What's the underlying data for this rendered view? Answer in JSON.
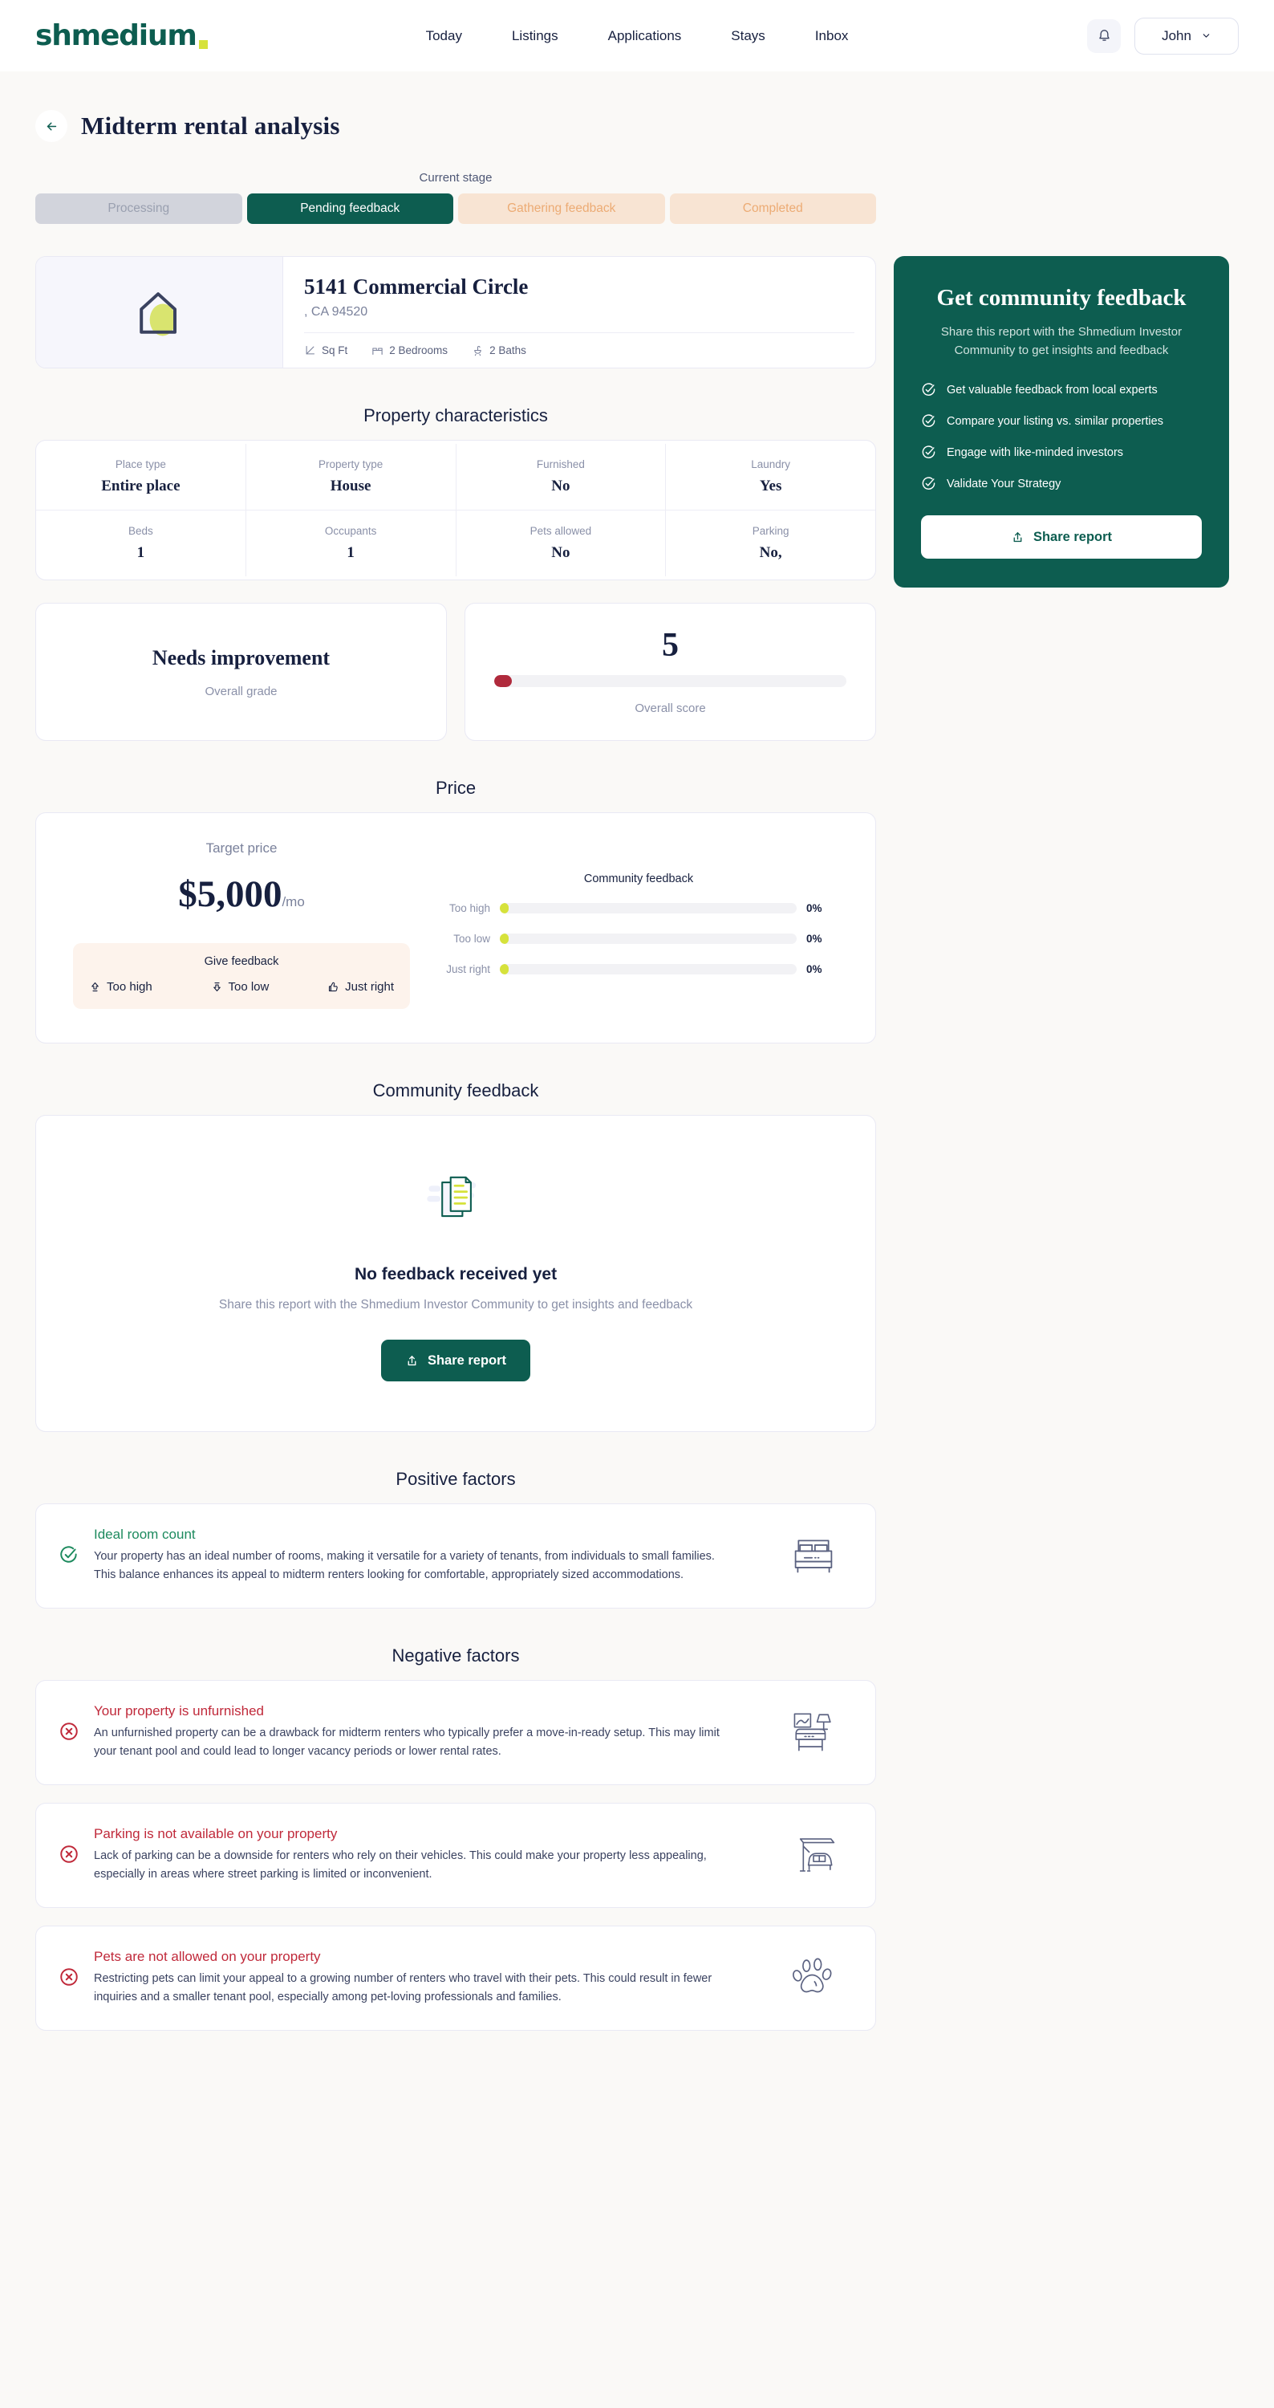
{
  "brand": {
    "name": "shmedium",
    "logo_color": "#0d5d50",
    "dot_color": "#d6e23b"
  },
  "nav": {
    "links": [
      "Today",
      "Listings",
      "Applications",
      "Stays",
      "Inbox"
    ],
    "bell_icon": "bell-icon",
    "user_name": "John",
    "user_caret": "chevron-down-icon"
  },
  "header": {
    "back_icon": "arrow-left-icon",
    "title": "Midterm rental analysis"
  },
  "stage": {
    "label": "Current stage",
    "items": [
      {
        "label": "Processing",
        "state": "done"
      },
      {
        "label": "Pending feedback",
        "state": "active"
      },
      {
        "label": "Gathering feedback",
        "state": "pending"
      },
      {
        "label": "Completed",
        "state": "pending"
      }
    ]
  },
  "property": {
    "thumb_icon": "house-icon",
    "address": "5141 Commercial Circle",
    "location": ", CA 94520",
    "specs": [
      {
        "icon": "area-icon",
        "label": "Sq Ft"
      },
      {
        "icon": "bed-icon",
        "label": "2 Bedrooms"
      },
      {
        "icon": "bath-icon",
        "label": "2 Baths"
      }
    ]
  },
  "characteristics": {
    "title": "Property characteristics",
    "rows": [
      [
        {
          "key": "Place type",
          "value": "Entire place"
        },
        {
          "key": "Property type",
          "value": "House"
        },
        {
          "key": "Furnished",
          "value": "No"
        },
        {
          "key": "Laundry",
          "value": "Yes"
        }
      ],
      [
        {
          "key": "Beds",
          "value": "1"
        },
        {
          "key": "Occupants",
          "value": "1"
        },
        {
          "key": "Pets allowed",
          "value": "No"
        },
        {
          "key": "Parking",
          "value": "No,"
        }
      ]
    ]
  },
  "community_panel": {
    "title": "Get community feedback",
    "subtitle": "Share this report with the Shmedium Investor Community to get insights and feedback",
    "bullets": [
      "Get valuable feedback from local experts",
      "Compare your listing vs. similar properties",
      "Engage with like-minded investors",
      "Validate Your Strategy"
    ],
    "share_label": "Share report",
    "share_icon": "share-icon",
    "bg_color": "#0d5d50"
  },
  "scores": {
    "grade_value": "Needs improvement",
    "grade_caption": "Overall grade",
    "score_value": "5",
    "score_caption": "Overall score",
    "score_fill_pct": 5,
    "score_fill_color": "#b02a3c"
  },
  "price": {
    "title": "Price",
    "target_caption": "Target price",
    "amount": "$5,000",
    "period": "/mo",
    "feedback_title": "Give feedback",
    "feedback_options": [
      {
        "icon": "arrow-up-icon",
        "label": "Too high"
      },
      {
        "icon": "arrow-down-icon",
        "label": "Too low"
      },
      {
        "icon": "thumbs-up-icon",
        "label": "Just right"
      }
    ],
    "community_title": "Community feedback",
    "bars": [
      {
        "label": "Too high",
        "pct": 0,
        "pct_label": "0%"
      },
      {
        "label": "Too low",
        "pct": 0,
        "pct_label": "0%"
      },
      {
        "label": "Just right",
        "pct": 0,
        "pct_label": "0%"
      }
    ],
    "bar_color": "#d6e23b"
  },
  "community_feedback": {
    "title": "Community feedback",
    "empty_icon": "document-icon",
    "empty_title": "No feedback received yet",
    "empty_sub": "Share this report with the Shmedium Investor Community to get insights and feedback",
    "share_label": "Share report",
    "share_icon": "share-icon"
  },
  "positive": {
    "title": "Positive factors",
    "items": [
      {
        "title": "Ideal room count",
        "desc": "Your property has an ideal number of rooms, making it versatile for a variety of tenants, from individuals to small families. This balance enhances its appeal to midterm renters looking for comfortable, appropriately sized accommodations.",
        "status_icon": "check-circle-icon",
        "art_icon": "bed-art-icon"
      }
    ]
  },
  "negative": {
    "title": "Negative factors",
    "items": [
      {
        "title": "Your property is unfurnished",
        "desc": "An unfurnished property can be a drawback for midterm renters who typically prefer a move-in-ready setup. This may limit your tenant pool and could lead to longer vacancy periods or lower rental rates.",
        "status_icon": "x-circle-icon",
        "art_icon": "furniture-art-icon"
      },
      {
        "title": "Parking is not available on your property",
        "desc": "Lack of parking can be a downside for renters who rely on their vehicles. This could make your property less appealing, especially in areas where street parking is limited or inconvenient.",
        "status_icon": "x-circle-icon",
        "art_icon": "carport-art-icon"
      },
      {
        "title": "Pets are not allowed on your property",
        "desc": "Restricting pets can limit your appeal to a growing number of renters who travel with their pets. This could result in fewer inquiries and a smaller tenant pool, especially among pet-loving professionals and families.",
        "status_icon": "x-circle-icon",
        "art_icon": "paw-art-icon"
      }
    ]
  }
}
